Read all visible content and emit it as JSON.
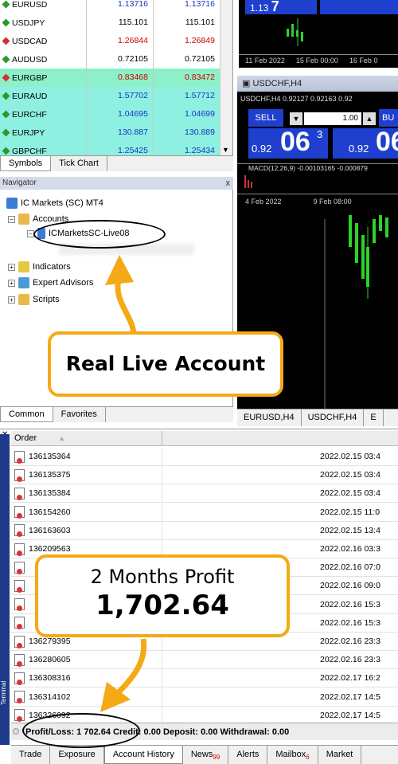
{
  "market_watch": {
    "rows": [
      {
        "symbol": "EURUSD",
        "bid": "1.13716",
        "ask": "1.13716",
        "dir": "up",
        "bg": "#ffffff",
        "color": "#1a34c0"
      },
      {
        "symbol": "USDJPY",
        "bid": "115.101",
        "ask": "115.101",
        "dir": "up",
        "bg": "#ffffff",
        "color": "#000000"
      },
      {
        "symbol": "USDCAD",
        "bid": "1.26844",
        "ask": "1.26849",
        "dir": "dn",
        "bg": "#ffffff",
        "color": "#d00000"
      },
      {
        "symbol": "AUDUSD",
        "bid": "0.72105",
        "ask": "0.72105",
        "dir": "up",
        "bg": "#ffffff",
        "color": "#000000"
      },
      {
        "symbol": "EURGBP",
        "bid": "0.83468",
        "ask": "0.83472",
        "dir": "dn",
        "bg": "#8ef0c8",
        "color": "#d00000"
      },
      {
        "symbol": "EURAUD",
        "bid": "1.57702",
        "ask": "1.57712",
        "dir": "up",
        "bg": "#8ef0e0",
        "color": "#1a34c0"
      },
      {
        "symbol": "EURCHF",
        "bid": "1.04695",
        "ask": "1.04699",
        "dir": "up",
        "bg": "#8ef0e0",
        "color": "#1a34c0"
      },
      {
        "symbol": "EURJPY",
        "bid": "130.887",
        "ask": "130.889",
        "dir": "up",
        "bg": "#8ef0e0",
        "color": "#1a34c0"
      },
      {
        "symbol": "GBPCHF",
        "bid": "1.25425",
        "ask": "1.25434",
        "dir": "up",
        "bg": "#8ef0e0",
        "color": "#1a34c0"
      }
    ],
    "tabs": [
      "Symbols",
      "Tick Chart"
    ]
  },
  "navigator": {
    "title": "Navigator",
    "close": "x",
    "root": "IC Markets (SC) MT4",
    "accounts": "Accounts",
    "account": "ICMarketsSC-Live08",
    "indicators": "Indicators",
    "experts": "Expert Advisors",
    "scripts": "Scripts",
    "tabs": [
      "Common",
      "Favorites"
    ]
  },
  "chart1": {
    "price": "1.13",
    "price_big": "7",
    "date1": "11 Feb 2022",
    "date2": "15 Feb 00:00",
    "date3": "16 Feb 0"
  },
  "chart2": {
    "window_title": "USDCHF,H4",
    "info": "USDCHF,H4  0.92127 0.92163 0.92",
    "sell": "SELL",
    "lot": "1.00",
    "buy": "BU",
    "sell_small": "0.92",
    "sell_big": "06",
    "sell_sup": "3",
    "buy_small": "0.92",
    "buy_big": "06",
    "macd": "MACD(12,26,9) -0.00103165 -0.000879",
    "date1": "4 Feb 2022",
    "date2": "9 Feb 08:00"
  },
  "chart_tabs": [
    "EURUSD,H4",
    "USDCHF,H4",
    "E"
  ],
  "terminal": {
    "col_order": "Order",
    "col_time": "",
    "rows": [
      {
        "order": "136135364",
        "time": "2022.02.15 03:4"
      },
      {
        "order": "136135375",
        "time": "2022.02.15 03:4"
      },
      {
        "order": "136135384",
        "time": "2022.02.15 03:4"
      },
      {
        "order": "136154260",
        "time": "2022.02.15 11:0"
      },
      {
        "order": "136163603",
        "time": "2022.02.15 13:4"
      },
      {
        "order": "136209563",
        "time": "2022.02.16 03:3"
      },
      {
        "order": "",
        "time": "2022.02.16 07:0"
      },
      {
        "order": "",
        "time": "2022.02.16 09:0"
      },
      {
        "order": "",
        "time": "2022.02.16 15:3"
      },
      {
        "order": "",
        "time": "2022.02.16 15:3"
      },
      {
        "order": "136279395",
        "time": "2022.02.16 23:3"
      },
      {
        "order": "136280605",
        "time": "2022.02.16 23:3"
      },
      {
        "order": "136308316",
        "time": "2022.02.17 16:2"
      },
      {
        "order": "136314102",
        "time": "2022.02.17 14:5"
      },
      {
        "order": "136326092",
        "time": "2022.02.17 14:5"
      }
    ],
    "summary": "Profit/Loss: 1 702.64  Credit: 0.00  Deposit: 0.00  Withdrawal: 0.00",
    "side_label": "Terminal",
    "tabs": [
      {
        "label": "Trade",
        "badge": ""
      },
      {
        "label": "Exposure",
        "badge": ""
      },
      {
        "label": "Account History",
        "badge": ""
      },
      {
        "label": "News",
        "badge": "99"
      },
      {
        "label": "Alerts",
        "badge": ""
      },
      {
        "label": "Mailbox",
        "badge": "6"
      },
      {
        "label": "Market",
        "badge": ""
      }
    ]
  },
  "callouts": {
    "live": "Real Live Account",
    "profit_title": "2 Months Profit",
    "profit_value": "1,702.64"
  },
  "colors": {
    "accent": "#f5a916",
    "sell_blue": "#1f3fcf"
  }
}
